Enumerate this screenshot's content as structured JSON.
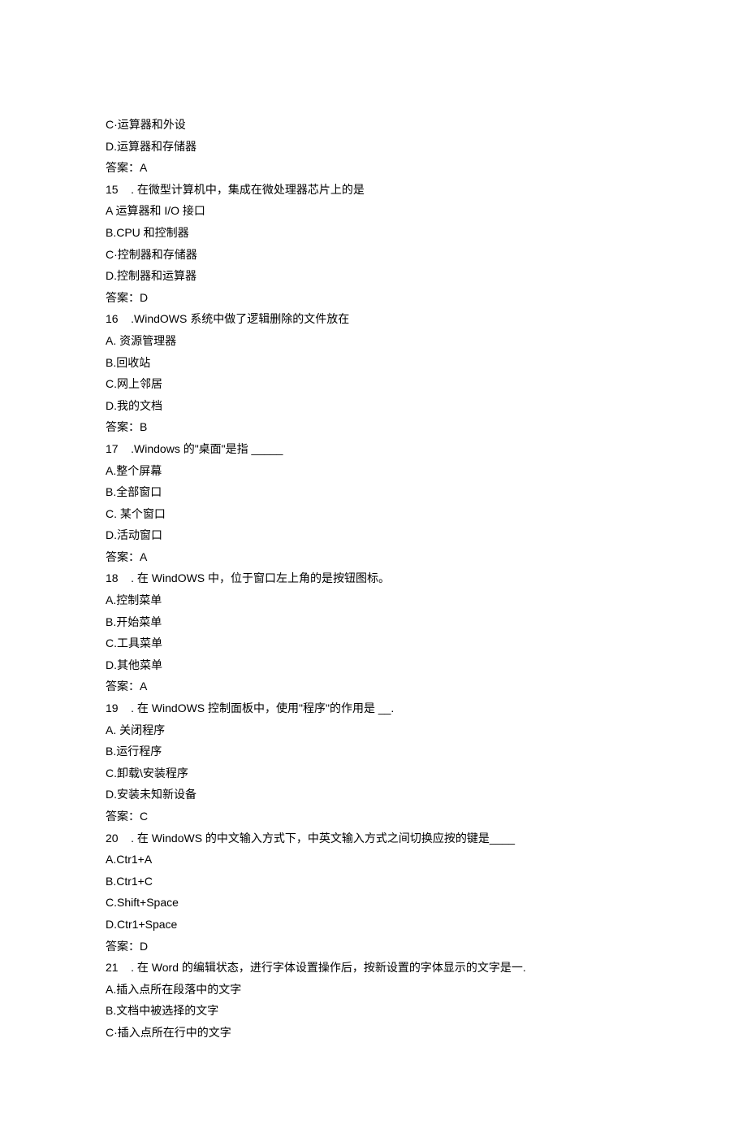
{
  "lines": [
    "C·运算器和外设",
    "D.运算器和存储器",
    "答案：A",
    "15    . 在微型计算机中，集成在微处理器芯片上的是",
    "A 运算器和 I/O 接口",
    "B.CPU 和控制器",
    "C·控制器和存储器",
    "D.控制器和运算器",
    "答案：D",
    "16    .WindOWS 系统中做了逻辑删除的文件放在",
    "A. 资源管理器",
    "B.回收站",
    "C.网上邻居",
    "D.我的文档",
    "答案：B",
    "17    .Windows 的\"桌面\"是指 _____",
    "A.整个屏幕",
    "B.全部窗口",
    "C. 某个窗口",
    "D.活动窗口",
    "答案：A",
    "18    . 在 WindOWS 中，位于窗口左上角的是按钮图标。",
    "A.控制菜单",
    "B.开始菜单",
    "C.工具菜单",
    "D.其他菜单",
    "答案：A",
    "19    . 在 WindOWS 控制面板中，使用\"程序\"的作用是 __.",
    "A. 关闭程序",
    "B.运行程序",
    "C.卸载\\安装程序",
    "D.安装未知新设备",
    "答案：C",
    "20    . 在 WindoWS 的中文输入方式下，中英文输入方式之间切换应按的键是____",
    "A.Ctr1+A",
    "B.Ctr1+C",
    "C.Shift+Space",
    "D.Ctr1+Space",
    "答案：D",
    "21    . 在 Word 的编辑状态，进行字体设置操作后，按新设置的字体显示的文字是一.",
    "A.插入点所在段落中的文字",
    "B.文档中被选择的文字",
    "C·插入点所在行中的文字"
  ]
}
